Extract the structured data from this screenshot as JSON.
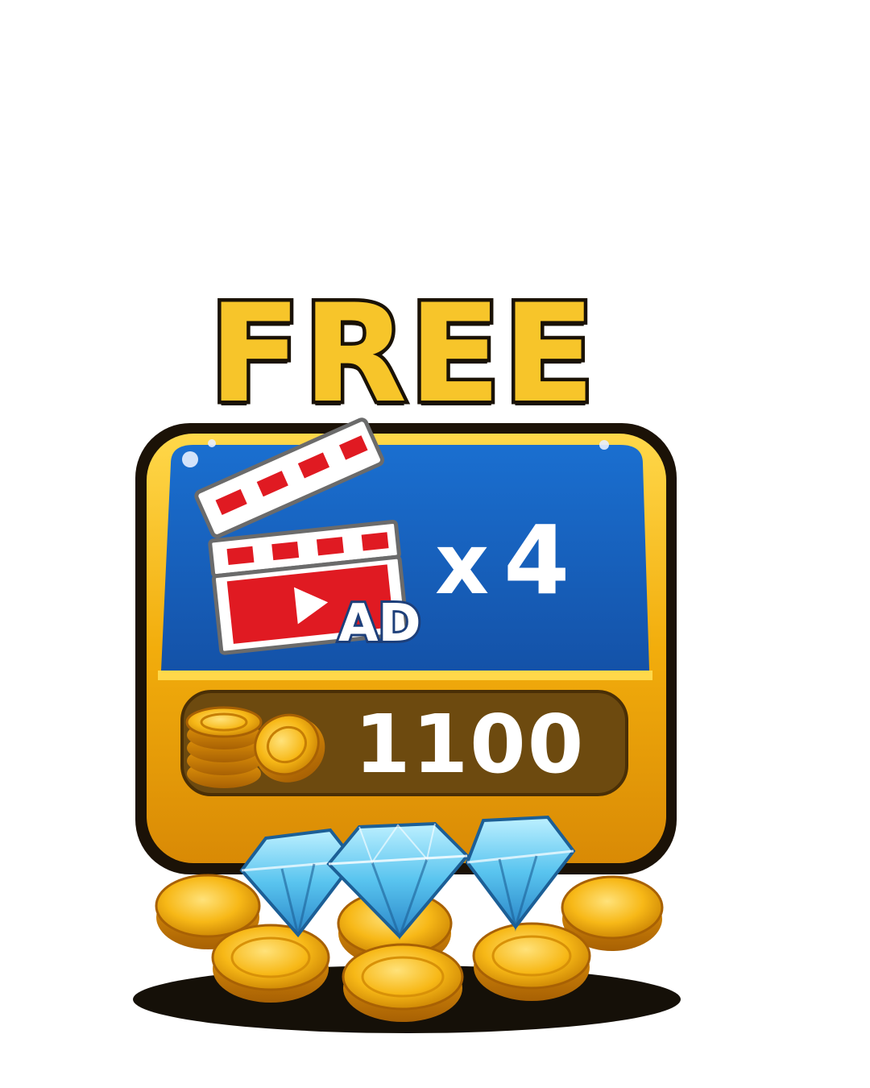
{
  "title": "FREE",
  "ad": {
    "label": "AD",
    "multiplier_symbol": "x",
    "count": "4"
  },
  "reward": {
    "coin_amount": "1100"
  },
  "icons": {
    "ad_icon": "clapperboard-play-icon",
    "coin_icon": "coin-stack-icon",
    "gem_icon": "diamond-icon"
  },
  "colors": {
    "title_fill": "#f7c52a",
    "panel_blue": "#1565c0",
    "panel_gold": "#f5b800",
    "amount_bar": "#6d4a0f",
    "clapper_red": "#e01a22",
    "gem_blue": "#54c6f0"
  }
}
